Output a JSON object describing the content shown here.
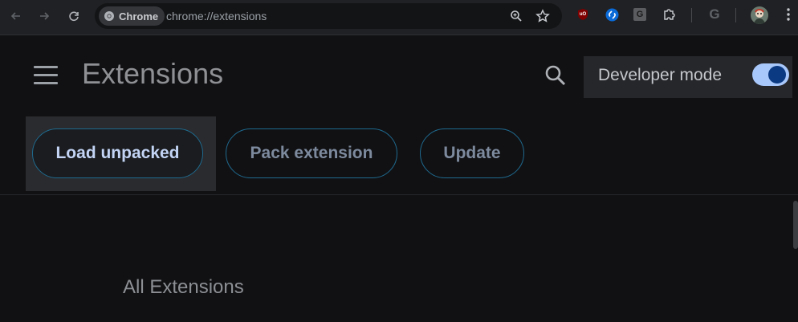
{
  "browser": {
    "chip_label": "Chrome",
    "url": "chrome://extensions",
    "icons": [
      "back-icon",
      "forward-icon",
      "reload-icon",
      "zoom-icon",
      "star-icon",
      "ublock-icon",
      "shazam-icon",
      "g-translate-icon",
      "puzzle-icon",
      "google-icon",
      "avatar",
      "kebab-menu-icon"
    ],
    "ublock_label": "uO",
    "gtranslate_label": "G",
    "google_label": "G"
  },
  "header": {
    "title": "Extensions",
    "developer_mode_label": "Developer mode",
    "developer_mode_on": true
  },
  "actions": {
    "load_unpacked": "Load unpacked",
    "pack_extension": "Pack extension",
    "update": "Update"
  },
  "main": {
    "section_title": "All Extensions"
  },
  "colors": {
    "background": "#111113",
    "toolbar": "#202124",
    "accent_border": "#1f6a8f",
    "toggle_track": "#a8c7fa",
    "toggle_knob": "#0b3a82"
  }
}
